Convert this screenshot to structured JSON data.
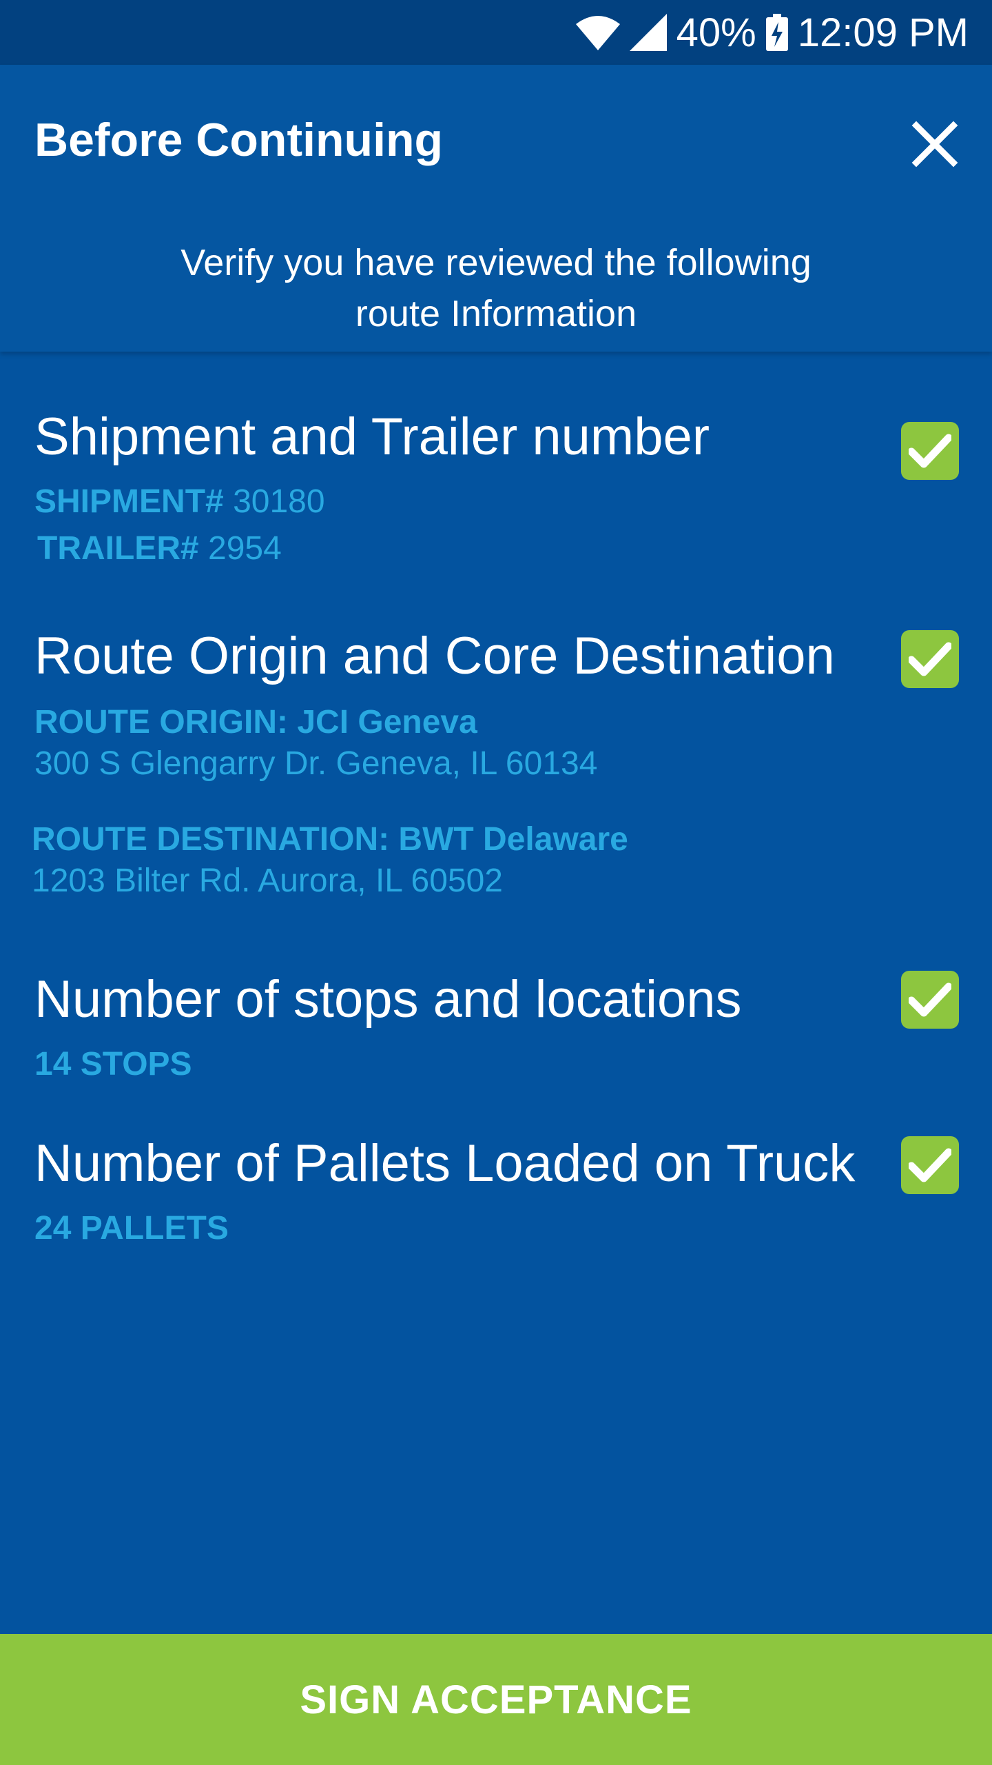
{
  "status_bar": {
    "battery": "40%",
    "time": "12:09 PM",
    "icons": [
      "wifi-icon",
      "signal-icon",
      "battery-charging-icon"
    ]
  },
  "header": {
    "title": "Before Continuing",
    "close_icon": "close-icon",
    "subtitle_line1": "Verify you have reviewed the following",
    "subtitle_line2": "route Information"
  },
  "sections": {
    "shipment": {
      "title": "Shipment and Trailer number",
      "checked": true,
      "shipment_label": "SHIPMENT#",
      "shipment_value": "30180",
      "trailer_label": "TRAILER#",
      "trailer_value": "2954"
    },
    "route": {
      "title": "Route Origin and Core Destination",
      "checked": true,
      "origin_label": "ROUTE ORIGIN: JCI Geneva",
      "origin_address": "300 S Glengarry Dr. Geneva, IL 60134",
      "destination_label": "ROUTE DESTINATION: BWT Delaware",
      "destination_address": "1203 Bilter Rd.  Aurora, IL 60502"
    },
    "stops": {
      "title": "Number of stops and locations",
      "checked": true,
      "value": "14 STOPS"
    },
    "pallets": {
      "title": "Number of Pallets Loaded on Truck",
      "checked": true,
      "value": "24 PALLETS"
    }
  },
  "footer": {
    "button_label": "SIGN ACCEPTANCE"
  },
  "colors": {
    "background": "#03539f",
    "header": "#0556a1",
    "status_bar": "#024180",
    "accent_green": "#8dc63f",
    "detail_text": "#29a9e1"
  }
}
